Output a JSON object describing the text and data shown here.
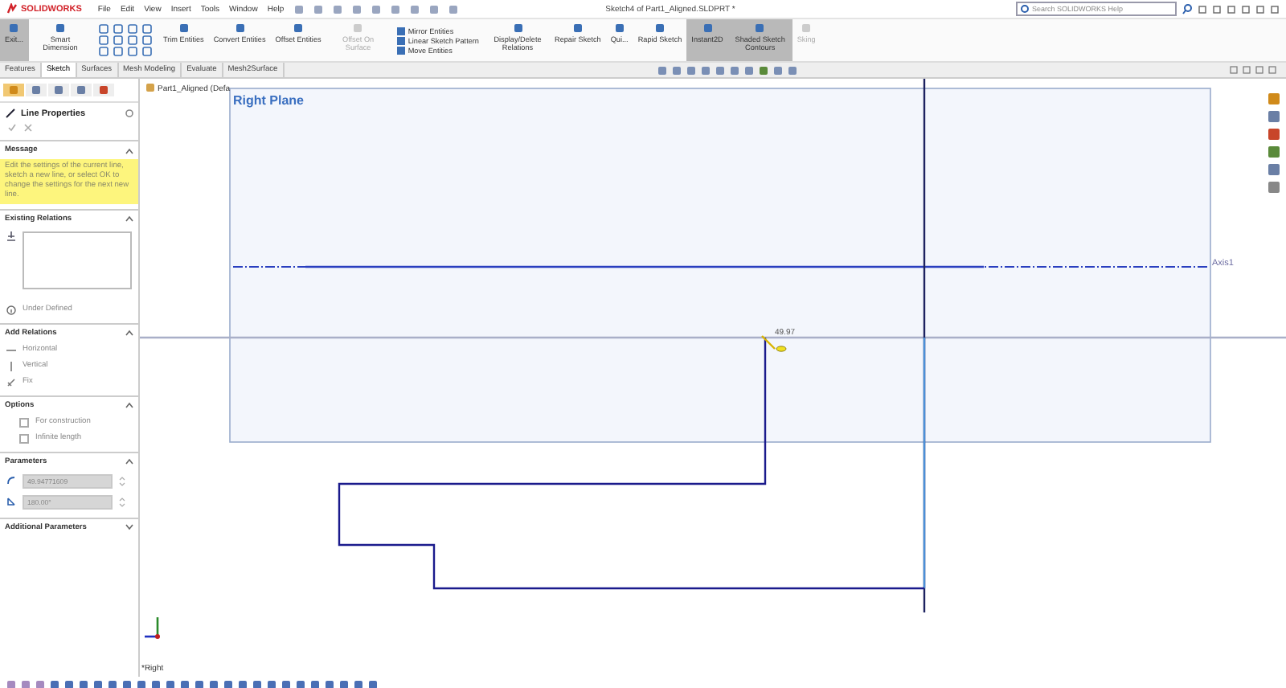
{
  "title_bar": {
    "logo": "SOLIDWORKS",
    "menus": [
      "File",
      "Edit",
      "View",
      "Insert",
      "Tools",
      "Window",
      "Help"
    ],
    "document_title": "Sketch4 of Part1_Aligned.SLDPRT *",
    "search": {
      "placeholder": "Search SOLIDWORKS Help"
    }
  },
  "ribbon": {
    "commands": [
      {
        "kind": "large",
        "label": "Exit...",
        "selected": true,
        "disabled": false
      },
      {
        "kind": "large",
        "label": "Smart Dimension",
        "selected": false,
        "disabled": false
      },
      {
        "kind": "tools",
        "selected": false,
        "disabled": false
      },
      {
        "kind": "large",
        "label": "Trim Entities",
        "selected": false,
        "disabled": false
      },
      {
        "kind": "large",
        "label": "Convert Entities",
        "selected": false,
        "disabled": false
      },
      {
        "kind": "large",
        "label": "Offset Entities",
        "selected": false,
        "disabled": false
      },
      {
        "kind": "large",
        "label": "Offset On Surface",
        "selected": false,
        "disabled": true
      },
      {
        "kind": "stack",
        "items": [
          "Mirror Entities",
          "Linear Sketch Pattern",
          "Move Entities"
        ],
        "selected": false,
        "disabled": false
      },
      {
        "kind": "large",
        "label": "Display/Delete Relations",
        "selected": false,
        "disabled": false
      },
      {
        "kind": "large",
        "label": "Repair Sketch",
        "selected": false,
        "disabled": false
      },
      {
        "kind": "large",
        "label": "Qui...",
        "selected": false,
        "disabled": false
      },
      {
        "kind": "large",
        "label": "Rapid Sketch",
        "selected": false,
        "disabled": false
      },
      {
        "kind": "large",
        "label": "Instant2D",
        "selected": true,
        "disabled": false
      },
      {
        "kind": "large",
        "label": "Shaded Sketch Contours",
        "selected": true,
        "disabled": false
      },
      {
        "kind": "large",
        "label": "Sking",
        "selected": false,
        "disabled": true
      }
    ]
  },
  "tabs": [
    {
      "label": "Features",
      "selected": false
    },
    {
      "label": "Sketch",
      "selected": true
    },
    {
      "label": "Surfaces",
      "selected": false
    },
    {
      "label": "Mesh Modeling",
      "selected": false
    },
    {
      "label": "Evaluate",
      "selected": false
    },
    {
      "label": "Mesh2Surface",
      "selected": false
    }
  ],
  "property_manager": {
    "title": "Line Properties",
    "message": {
      "heading": "Message",
      "expanded": true,
      "text": "Edit the settings of the current line, sketch a new line, or select OK to change the settings for the next new line."
    },
    "existing_relations": {
      "heading": "Existing Relations",
      "expanded": true,
      "status": "Under Defined"
    },
    "add_relations": {
      "heading": "Add Relations",
      "expanded": true,
      "items": [
        {
          "kind": "horizontal",
          "label": "Horizontal"
        },
        {
          "kind": "vertical",
          "label": "Vertical"
        },
        {
          "kind": "fix",
          "label": "Fix"
        }
      ]
    },
    "options": {
      "heading": "Options",
      "expanded": true,
      "items": [
        {
          "label": "For construction",
          "checked": false
        },
        {
          "label": "Infinite length",
          "checked": false
        }
      ]
    },
    "parameters": {
      "heading": "Parameters",
      "expanded": true,
      "fields": [
        {
          "kind": "length",
          "value": "49.94771609"
        },
        {
          "kind": "angle",
          "value": "180.00°"
        }
      ]
    },
    "additional_parameters": {
      "heading": "Additional Parameters",
      "expanded": false
    }
  },
  "viewport": {
    "tree_label": "Part1_Aligned (Defa",
    "plane_label": "Right Plane",
    "axis_label": "Axis1",
    "dimension": "49.97",
    "view_label": "*Right"
  }
}
